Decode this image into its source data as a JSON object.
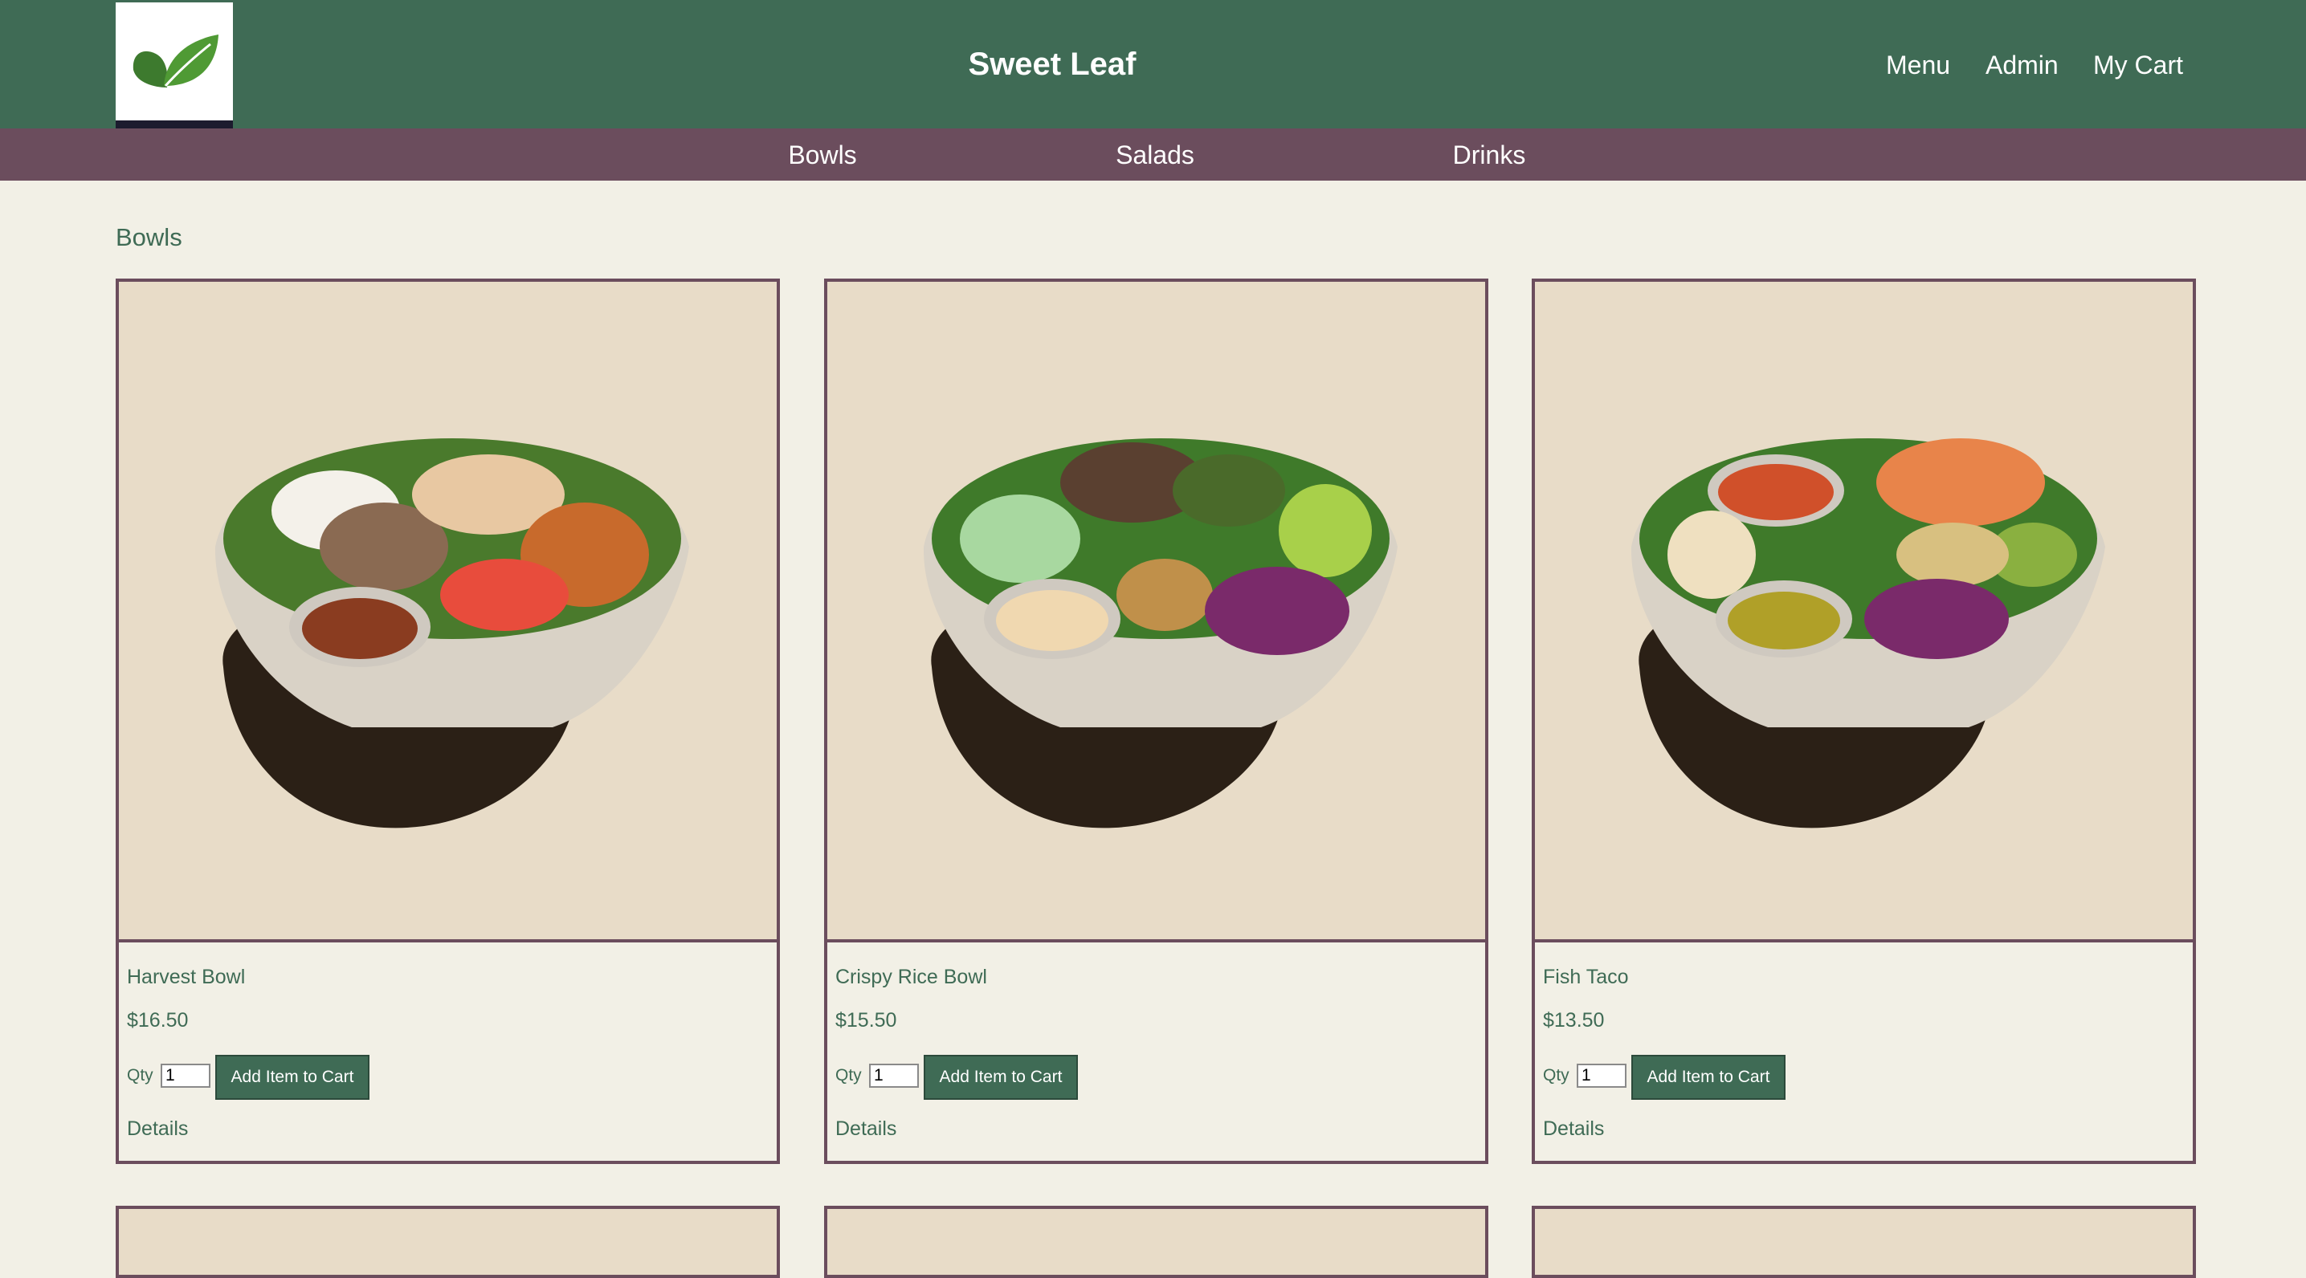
{
  "header": {
    "site_title": "Sweet Leaf",
    "nav": [
      {
        "label": "Menu"
      },
      {
        "label": "Admin"
      },
      {
        "label": "My Cart"
      }
    ],
    "colors": {
      "header_bg": "#3f6b55",
      "subnav_bg": "#6b4d5d",
      "page_bg": "#f2f0e6",
      "image_bg": "#e8dcc8"
    }
  },
  "subnav": {
    "categories": [
      {
        "label": "Bowls"
      },
      {
        "label": "Salads"
      },
      {
        "label": "Drinks"
      }
    ]
  },
  "section": {
    "heading": "Bowls"
  },
  "products": [
    {
      "name": "Harvest Bowl",
      "price": "$16.50",
      "qty_label": "Qty",
      "qty_value": "1",
      "button_label": "Add Item to Cart",
      "details_label": "Details",
      "image_icon": "harvest-bowl-image"
    },
    {
      "name": "Crispy Rice Bowl",
      "price": "$15.50",
      "qty_label": "Qty",
      "qty_value": "1",
      "button_label": "Add Item to Cart",
      "details_label": "Details",
      "image_icon": "crispy-rice-bowl-image"
    },
    {
      "name": "Fish Taco",
      "price": "$13.50",
      "qty_label": "Qty",
      "qty_value": "1",
      "button_label": "Add Item to Cart",
      "details_label": "Details",
      "image_icon": "fish-taco-bowl-image"
    }
  ]
}
